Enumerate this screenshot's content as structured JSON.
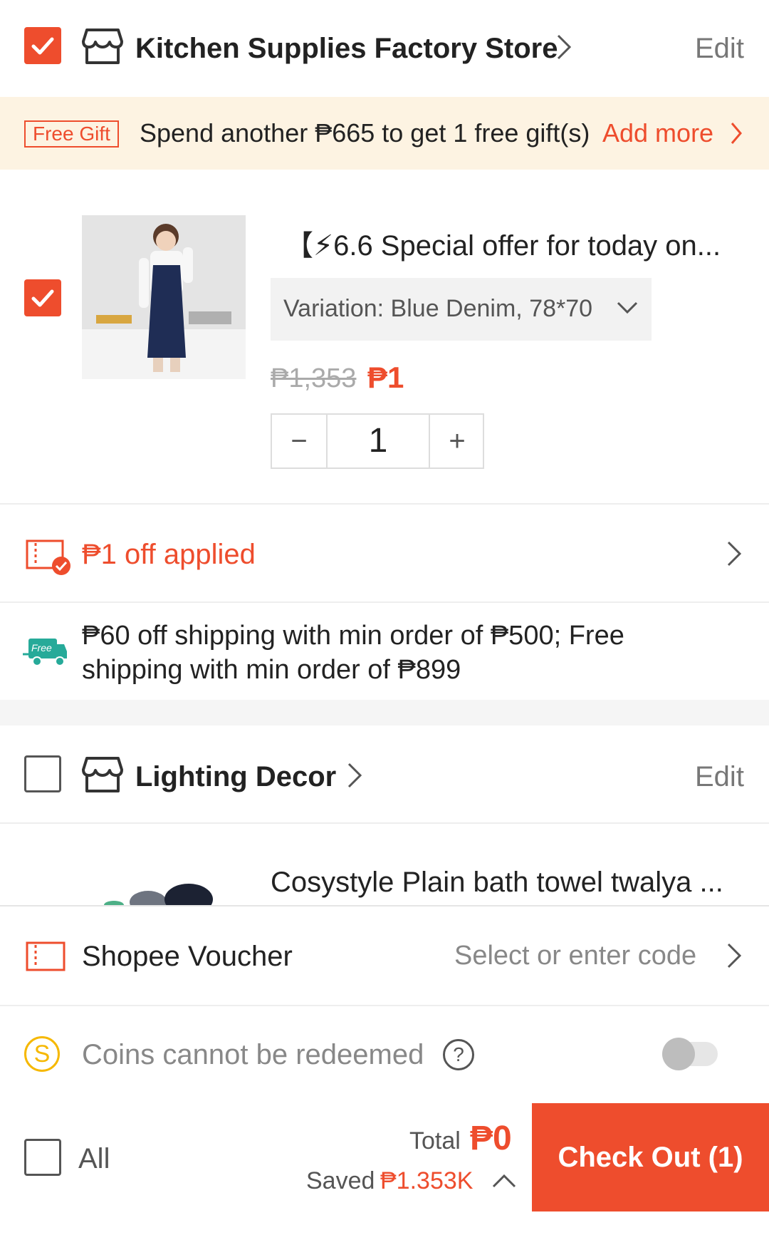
{
  "colors": {
    "accent": "#ee4d2d",
    "gift_bg": "#fdf3e2",
    "muted": "#888888"
  },
  "store1": {
    "name": "Kitchen Supplies Factory Store",
    "edit": "Edit",
    "checked": true
  },
  "gift": {
    "tag": "Free Gift",
    "text": "Spend another ₱665 to get 1 free gift(s)",
    "action": "Add more"
  },
  "product1": {
    "title": "【⚡6.6 Special offer for today on...",
    "variation": "Variation: Blue Denim, 78*70",
    "price_original": "₱1,353",
    "price_current": "₱1",
    "quantity": "1",
    "minus": "−",
    "plus": "+",
    "checked": true
  },
  "discount": {
    "text": "₱1 off applied"
  },
  "shipping": {
    "icon_label": "Free",
    "text": "₱60 off shipping with min order of ₱500; Free shipping with min order of ₱899"
  },
  "store2": {
    "name": "Lighting Decor",
    "edit": "Edit",
    "checked": false
  },
  "product2": {
    "title": "Cosystyle Plain bath towel twalya ..."
  },
  "voucher": {
    "label": "Shopee Voucher",
    "placeholder": "Select or enter code"
  },
  "coins": {
    "label": "Coins cannot be redeemed",
    "icon": "S",
    "help": "?",
    "toggle_on": false
  },
  "footer": {
    "all": "All",
    "total_label": "Total",
    "total_value": "₱0",
    "saved_label": "Saved",
    "saved_value": "₱1.353K",
    "checkout": "Check Out (1)"
  }
}
